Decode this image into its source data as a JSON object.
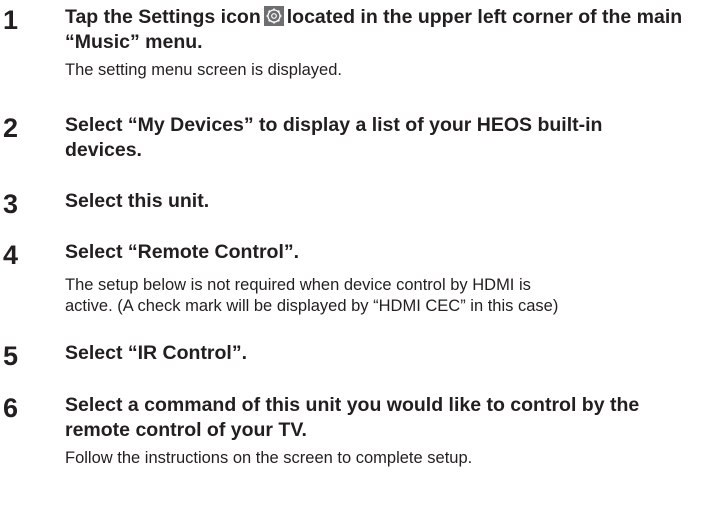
{
  "steps": [
    {
      "number": "1",
      "heading_before_icon": "Tap the Settings icon",
      "heading_after_icon": "located in the upper left corner of the main “Music” menu.",
      "icon": "settings-icon",
      "body": "The setting menu screen is displayed."
    },
    {
      "number": "2",
      "heading": "Select “My Devices” to display a list of your HEOS built-in devices."
    },
    {
      "number": "3",
      "heading": "Select this unit."
    },
    {
      "number": "4",
      "heading": "Select “Remote Control”.",
      "body_line1": "The setup below is not required when device control by HDMI is",
      "body_line2": "active. (A check mark will be displayed by “HDMI CEC” in this case)"
    },
    {
      "number": "5",
      "heading": "Select “IR Control”."
    },
    {
      "number": "6",
      "heading": "Select a command of this unit you would like to control by the remote control of your TV.",
      "body": "Follow the instructions on the screen to complete setup."
    }
  ],
  "colors": {
    "text": "#231f20",
    "icon_bg": "#6d6e71",
    "icon_fg": "#ffffff"
  }
}
